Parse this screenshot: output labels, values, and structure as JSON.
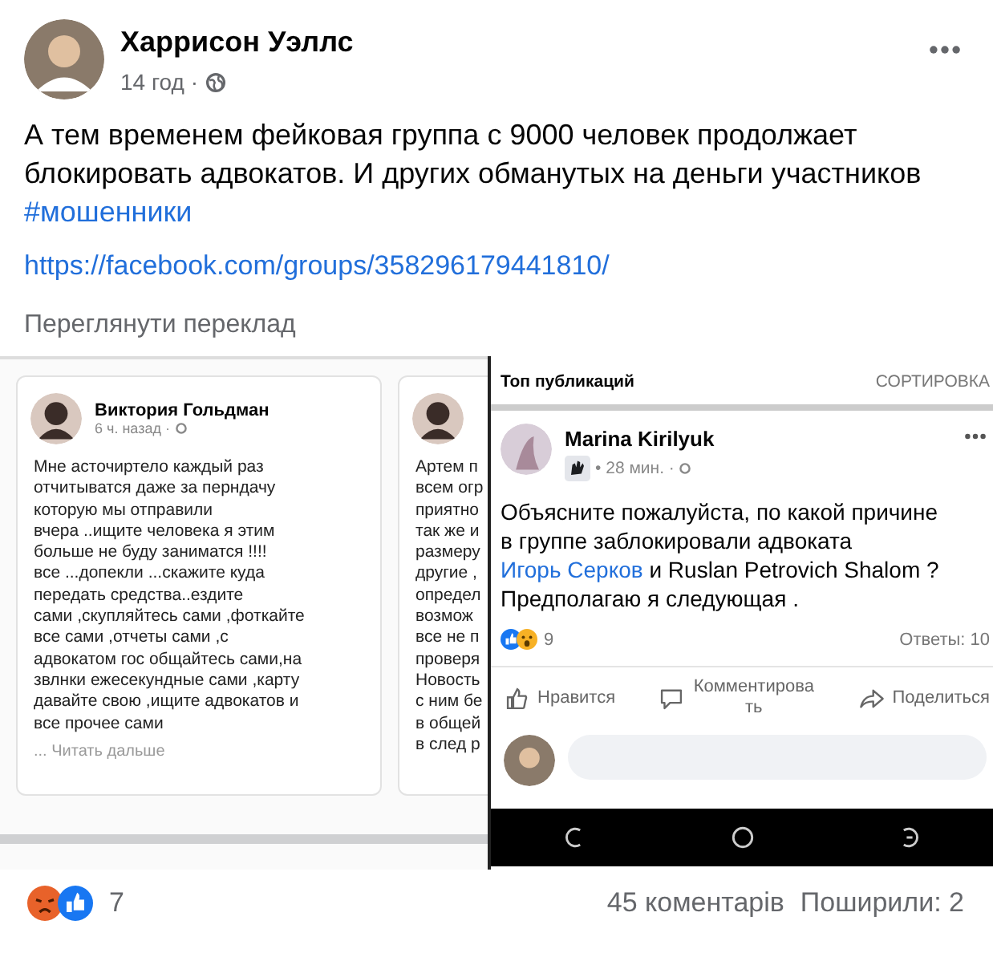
{
  "post": {
    "author": "Харрисон Уэллс",
    "time": "14 год",
    "separator": "·",
    "text": [
      "А тем временем фейковая группа с 9000 человек продолжает блокировать адвокатов. И других обманутых на деньги участников"
    ],
    "hashtag": "#мошенники",
    "link": "https://facebook.com/groups/358296179441810/",
    "translate": "Переглянути переклад"
  },
  "screenshot_left": {
    "cards": [
      {
        "author": "Виктория Гольдман",
        "time": "6 ч. назад ·",
        "lines": [
          "Мне асточиртело каждый раз",
          "отчитыватся даже за перндачу",
          "которую мы отправили",
          "вчера  ..ищите человека я этим",
          "больше не буду заниматся !!!!",
          "все ...допекли ...скажите куда",
          "передать средства..ездите",
          "сами ,скупляйтесь сами ,фоткайте",
          "все сами ,отчеты сами ,с",
          "адвокатом гос общайтесь сами,на",
          "звлнки ежесекундные сами ,карту",
          "давайте свою ,ищите адвокатов и",
          "все прочее сами"
        ],
        "more": "... Читать дальше"
      },
      {
        "lines": [
          "Артем п",
          "всем огр",
          "приятно",
          "так же и",
          "размеру",
          "другие ,",
          "определ",
          "возмож",
          "все не п",
          "проверя",
          "Новость",
          "с ним бе",
          "в общей",
          "в след р"
        ]
      }
    ]
  },
  "screenshot_right": {
    "header": "Топ публикаций",
    "sort": "СОРТИРОВКА",
    "comment": {
      "author": "Marina Kirilyuk",
      "time": "• 28 мин. ·",
      "text": "Объясните пожалуйста, по какой причине в группе  заблокировали адвоката ",
      "mention": "Игорь Серков",
      "text_after": "  и Ruslan Petrovich Shalom ? Предполагаю я следующая .",
      "reaction_count": "9",
      "replies": "Ответы: 10"
    },
    "actions": [
      {
        "kind": "like",
        "label": "Нравится"
      },
      {
        "kind": "comment",
        "label": "Комментировать"
      },
      {
        "kind": "share",
        "label": "Поделиться"
      }
    ]
  },
  "footer": {
    "reaction_count": "7",
    "comments": "45 коментарів",
    "shares": "Поширили: 2"
  }
}
